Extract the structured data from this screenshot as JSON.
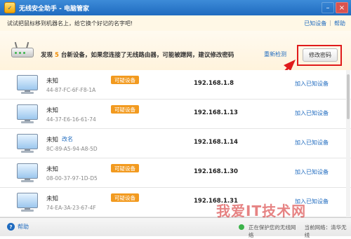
{
  "window": {
    "title": "无线安全助手 - 电脑管家"
  },
  "tipbar": {
    "tip": "试试把鼠标移到机器名上，给它换个好记的名字吧!",
    "links": [
      "已知设备",
      "帮助"
    ]
  },
  "notice": {
    "prefix": "发现",
    "count": "5",
    "suffix": "台新设备，如果您连接了无线路由器，可能被蹭网，建议修改密码",
    "rescan": "重新检测",
    "change_password": "修改密码"
  },
  "devices": [
    {
      "name": "未知",
      "rename": "",
      "badge": "可疑设备",
      "mac": "44-87-FC-6F-F8-1A",
      "ip": "192.168.1.8",
      "action": "加入已知设备"
    },
    {
      "name": "未知",
      "rename": "",
      "badge": "可疑设备",
      "mac": "44-37-E6-16-61-74",
      "ip": "192.168.1.13",
      "action": "加入已知设备"
    },
    {
      "name": "未知",
      "rename": "改名",
      "badge": "",
      "mac": "8C-89-A5-94-A8-5D",
      "ip": "192.168.1.14",
      "action": "加入已知设备"
    },
    {
      "name": "未知",
      "rename": "",
      "badge": "可疑设备",
      "mac": "08-00-37-97-1D-D5",
      "ip": "192.168.1.30",
      "action": "加入已知设备"
    },
    {
      "name": "未知",
      "rename": "",
      "badge": "可疑设备",
      "mac": "74-EA-3A-23-67-4F",
      "ip": "192.168.1.31",
      "action": "加入已知设备"
    }
  ],
  "footer": {
    "help": "帮助",
    "status_left": "正在保护您的无线网络",
    "status_right": "当前网络：清华无线"
  },
  "watermark": "我爱IT技术网",
  "colors": {
    "accent": "#1f6bbf",
    "badge": "#f29a1f",
    "highlight": "#e01b1b"
  }
}
